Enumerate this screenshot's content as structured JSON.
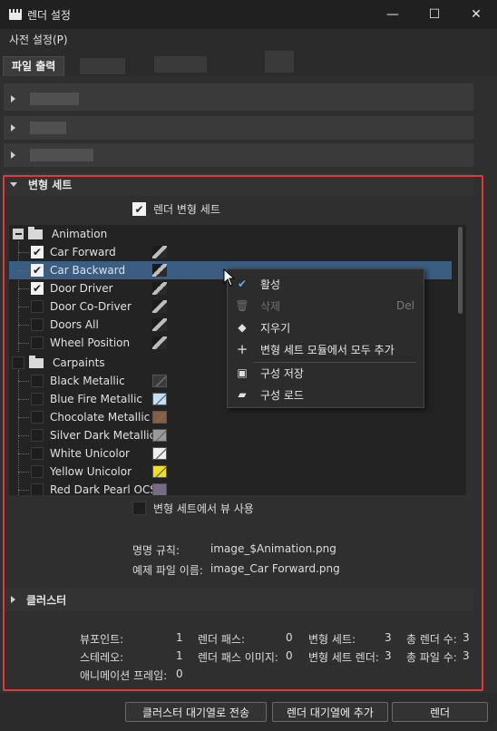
{
  "window": {
    "title": "렌더 설정",
    "minimize": "—",
    "maximize": "☐",
    "close": "✕"
  },
  "menu": {
    "presets": "사전 설정(P)"
  },
  "tabs": {
    "active": "파일 출력"
  },
  "sections": {
    "variant_sets": "변형 세트",
    "cluster": "클러스터"
  },
  "variant": {
    "render_variant_sets": "렌더 변형 세트",
    "use_view_from_variant_sets": "변형 세트에서 뷰 사용"
  },
  "tree": {
    "animation_group": "Animation",
    "animation_items": [
      {
        "label": "Car Forward",
        "checked": true
      },
      {
        "label": "Car Backward",
        "checked": true,
        "selected": true
      },
      {
        "label": "Door Driver",
        "checked": true
      },
      {
        "label": "Door Co-Driver",
        "checked": false
      },
      {
        "label": "Doors All",
        "checked": false
      },
      {
        "label": "Wheel Position",
        "checked": false
      }
    ],
    "carpaints_group": "Carpaints",
    "carpaint_items": [
      {
        "label": "Black Metallic",
        "color": "#3a3a3a"
      },
      {
        "label": "Blue Fire Metallic",
        "color": "#bfe0f5"
      },
      {
        "label": "Chocolate Metallic",
        "color": "#8a5e3c"
      },
      {
        "label": "Silver Dark Metallic",
        "color": "#9a9a9a"
      },
      {
        "label": "White Unicolor",
        "color": "#efefef"
      },
      {
        "label": "Yellow Unicolor",
        "color": "#f0e020"
      },
      {
        "label": "Red Dark Pearl OCS",
        "color": "#7a6a8a"
      }
    ]
  },
  "context_menu": {
    "activate": "활성",
    "delete": "삭제",
    "delete_shortcut": "Del",
    "clear": "지우기",
    "add_all": "변형 세트 모듈에서 모두 추가",
    "save_config": "구성 저장",
    "load_config": "구성 로드"
  },
  "naming": {
    "rule_label": "명명 규칙:",
    "rule_value": "image_$Animation.png",
    "example_label": "예제 파일 이름:",
    "example_value": "image_Car Forward.png"
  },
  "stats": {
    "viewpoints_label": "뷰포인트:",
    "viewpoints_value": "1",
    "render_passes_label": "렌더 패스:",
    "render_passes_value": "0",
    "variant_sets_label": "변형 세트:",
    "variant_sets_value": "3",
    "total_renders_label": "총 렌더 수:",
    "total_renders_value": "3",
    "stereo_label": "스테레오:",
    "stereo_value": "1",
    "pass_images_label": "렌더 패스 이미지:",
    "pass_images_value": "0",
    "variant_renders_label": "변형 세트 렌더:",
    "variant_renders_value": "3",
    "total_files_label": "총 파일 수:",
    "total_files_value": "3",
    "anim_frames_label": "애니메이션 프레임:",
    "anim_frames_value": "0"
  },
  "footer": {
    "send_cluster": "클러스터 대기열로 전송",
    "add_queue": "렌더 대기열에 추가",
    "render": "렌더"
  },
  "colors": {
    "accent_selection": "#3b5d82",
    "highlight_frame": "#e03a3a"
  }
}
